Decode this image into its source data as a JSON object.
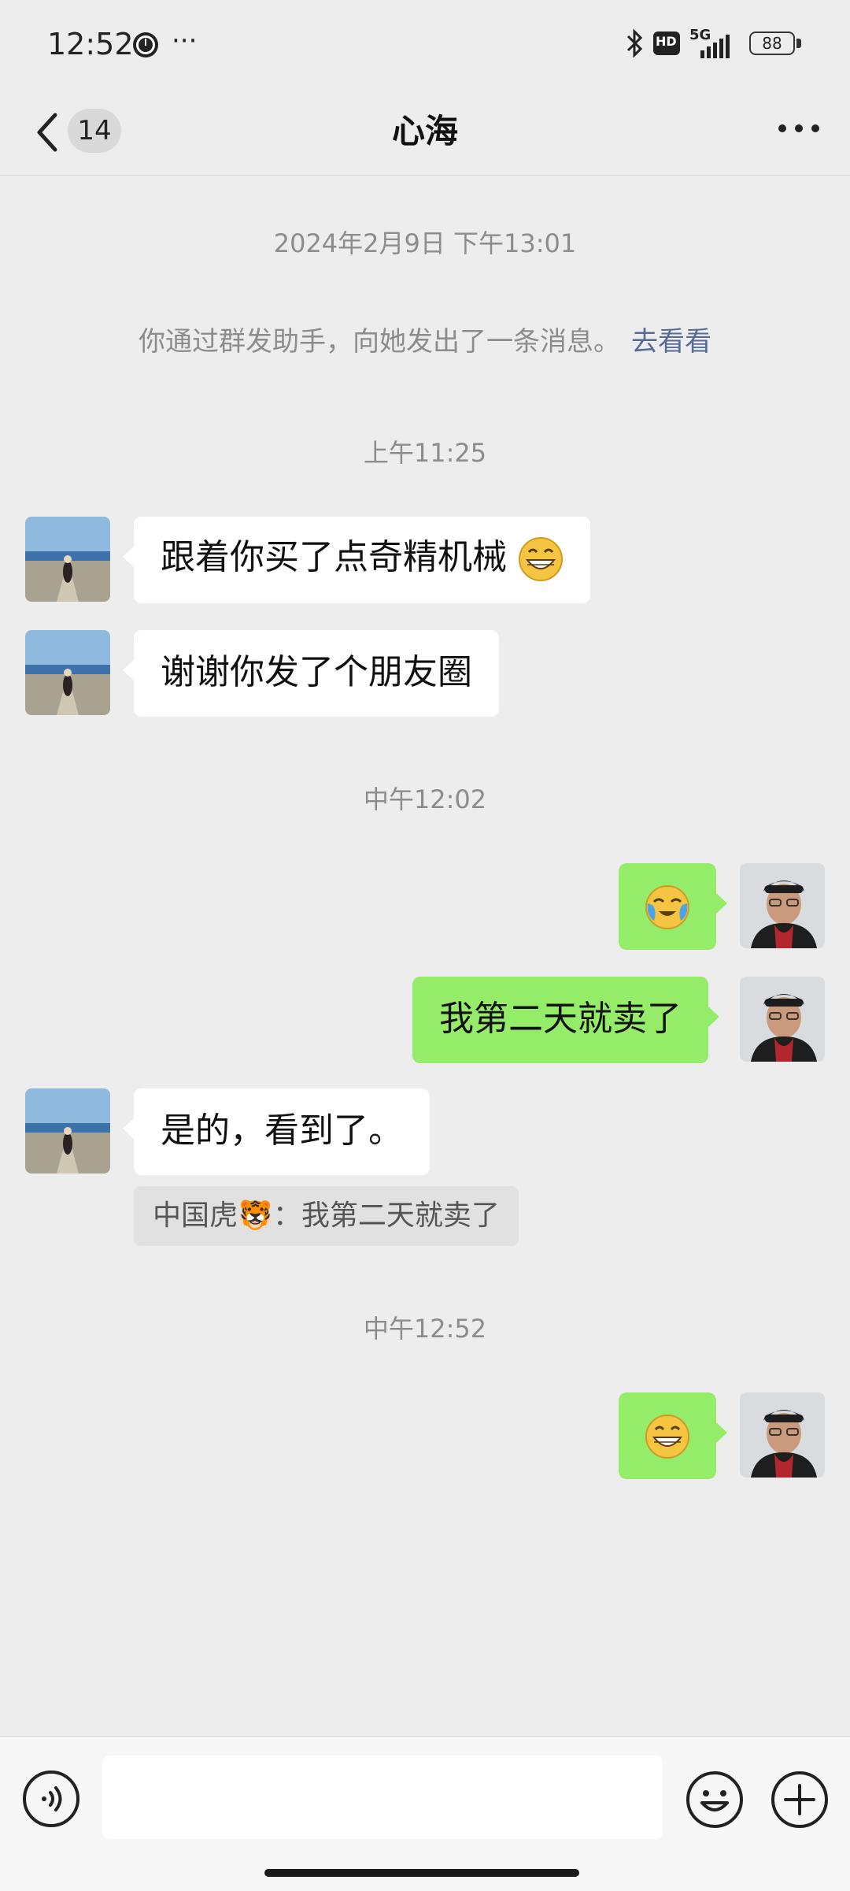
{
  "status_bar": {
    "time": "12:52",
    "more": "···",
    "network": "5G",
    "hd": "HD",
    "battery": "88",
    "icons": [
      "clock-icon",
      "more-dots-icon",
      "bluetooth-icon",
      "hd-icon",
      "signal-5g-icon",
      "battery-icon"
    ]
  },
  "header": {
    "title": "心海",
    "unread_count": "14",
    "icons": [
      "back-arrow-icon",
      "more-options-icon"
    ]
  },
  "chat": {
    "system_date": "2024年2月9日 下午13:01",
    "group_notice": "你通过群发助手，向她发出了一条消息。",
    "group_notice_link": "去看看",
    "time_1": "上午11:25",
    "msg_1": "跟着你买了点奇精机械",
    "msg_2": "谢谢你发了个朋友圈",
    "time_2": "中午12:02",
    "msg_3_emoji": "crying-laughing-emoji",
    "msg_4": "我第二天就卖了",
    "msg_5": "是的，看到了。",
    "msg_5_quote": "中国虎🐯：我第二天就卖了",
    "time_3": "中午12:52",
    "msg_6_emoji": "grin-emoji"
  },
  "bottom_bar": {
    "input_placeholder": "",
    "icons": [
      "voice-icon",
      "emoji-icon",
      "plus-icon"
    ]
  },
  "colors": {
    "background": "#ededed",
    "bubble_out": "#95ec69",
    "bubble_in": "#ffffff",
    "link": "#576b95"
  }
}
